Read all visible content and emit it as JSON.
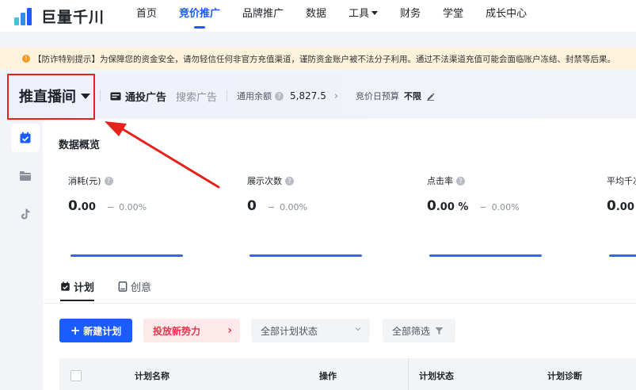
{
  "brand": {
    "name": "巨量千川"
  },
  "nav": {
    "items": [
      {
        "label": "首页",
        "active": false
      },
      {
        "label": "竞价推广",
        "active": true
      },
      {
        "label": "品牌推广",
        "active": false
      },
      {
        "label": "数据",
        "active": false
      },
      {
        "label": "工具",
        "active": false,
        "dropdown": true
      },
      {
        "label": "财务",
        "active": false
      },
      {
        "label": "学堂",
        "active": false
      },
      {
        "label": "成长中心",
        "active": false
      }
    ]
  },
  "notice": {
    "text": "【防诈特别提示】为保障您的资金安全，请勿轻信任何非官方充值渠道，谨防资金账户被不法分子利用。通过不法渠道充值可能会面临账户冻结、封禁等后果。"
  },
  "account": {
    "name": "推直播间",
    "ad_type": "通投广告",
    "ad_search": "搜索广告",
    "balance_label": "通用余额",
    "balance_value": "5,827.5",
    "budget_label": "竞价日预算",
    "budget_value": "不限"
  },
  "overview": {
    "title": "数据概览",
    "metrics": [
      {
        "label": "消耗(元)",
        "value_main": "0",
        "value_small": ".00",
        "dash": "−",
        "pct": "0.00%"
      },
      {
        "label": "展示次数",
        "value_main": "0",
        "value_small": "",
        "dash": "−",
        "pct": "0.00%"
      },
      {
        "label": "点击率",
        "value_main": "0",
        "value_small": ".00 %",
        "dash": "−",
        "pct": "0.00%"
      },
      {
        "label": "平均千次",
        "value_main": "0",
        "value_small": ".00",
        "dash": "",
        "pct": ""
      }
    ]
  },
  "tabs": [
    {
      "label": "计划",
      "active": true
    },
    {
      "label": "创意",
      "active": false
    }
  ],
  "toolbar": {
    "new_plan": "新建计划",
    "promo": "投放新势力",
    "status_select": "全部计划状态",
    "filter": "全部筛选"
  },
  "table": {
    "headers": [
      "计划名称",
      "操作",
      "计划状态",
      "计划诊断"
    ]
  },
  "colors": {
    "accent": "#1a5cff",
    "highlight": "#e8221a",
    "notice_bg": "#fdf3dc"
  }
}
